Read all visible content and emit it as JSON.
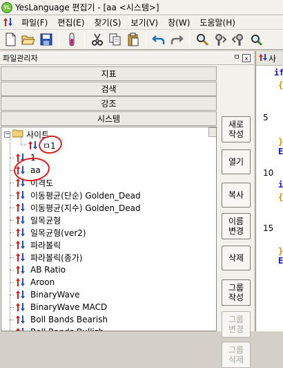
{
  "window": {
    "title": "YesLanguage 편집기 - [aa <시스템>]",
    "app_icon": "YL"
  },
  "menu": [
    "파일(F)",
    "편집(E)",
    "찾기(S)",
    "보기(V)",
    "창(W)",
    "도움말(H)"
  ],
  "toolbar": [
    "new-file-icon",
    "open-folder-icon",
    "save-icon",
    "test-tube-icon",
    "cut-icon",
    "copy-icon",
    "paste-icon",
    "undo-icon",
    "redo-icon",
    "find-icon",
    "find-next-icon",
    "find-prev-icon",
    "replace-icon"
  ],
  "panel": {
    "title": "파일관리자",
    "pin": "ㅁ",
    "close": "x",
    "categories": [
      "지표",
      "검색",
      "강조",
      "시스템"
    ]
  },
  "tree": {
    "folder": "사이트",
    "child": "ㅁ1",
    "items": [
      "1",
      "aa",
      "이격도",
      "이동평균(단순) Golden_Dead",
      "이동평균(지수) Golden_Dead",
      "일목균형",
      "일목균형(ver2)",
      "파라볼릭",
      "파라볼릭(종가)",
      "AB Ratio",
      "Aroon",
      "BinaryWave",
      "BinaryWave MACD",
      "Boll Bands Bearish",
      "Boll Bands Bullish"
    ]
  },
  "side_buttons": [
    {
      "label": "새로\n작성",
      "enabled": true
    },
    {
      "label": "열기",
      "enabled": true
    },
    {
      "label": "복사",
      "enabled": true
    },
    {
      "label": "이름\n변경",
      "enabled": true
    },
    {
      "label": "삭제",
      "enabled": true
    },
    {
      "label": "그룹\n작성",
      "enabled": true
    },
    {
      "label": "그룹\n변경",
      "enabled": false
    },
    {
      "label": "그룹\n삭제",
      "enabled": false
    }
  ],
  "editor": {
    "tab": "사",
    "line_numbers": [
      "5",
      "10",
      "15"
    ],
    "code_fragments": [
      "if",
      "{",
      "}",
      "E",
      "i",
      "{",
      "}",
      "E"
    ]
  },
  "colors": {
    "up_arrow": "#d7191b",
    "down_arrow": "#1a4fc8",
    "annotation": "#e01919",
    "keyword": "#1111cc",
    "brace": "#c8930b"
  }
}
